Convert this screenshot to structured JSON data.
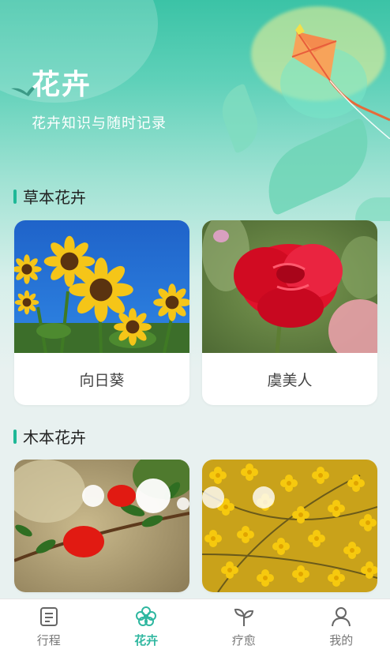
{
  "header": {
    "title": "花卉",
    "subtitle": "花卉知识与随时记录"
  },
  "sections": [
    {
      "title": "草本花卉",
      "items": [
        {
          "label": "向日葵"
        },
        {
          "label": "虞美人"
        }
      ]
    },
    {
      "title": "木本花卉",
      "items": [
        {
          "label": ""
        },
        {
          "label": ""
        }
      ]
    }
  ],
  "tabbar": {
    "active": "花卉",
    "tabs": [
      {
        "label": "行程",
        "icon": "itinerary-icon"
      },
      {
        "label": "花卉",
        "icon": "flower-icon"
      },
      {
        "label": "疗愈",
        "icon": "sprout-icon"
      },
      {
        "label": "我的",
        "icon": "user-icon"
      }
    ]
  },
  "colors": {
    "accent": "#2fb7a0",
    "header_gradient_top": "#3bc3a6",
    "page_background": "#e8f1f0"
  }
}
